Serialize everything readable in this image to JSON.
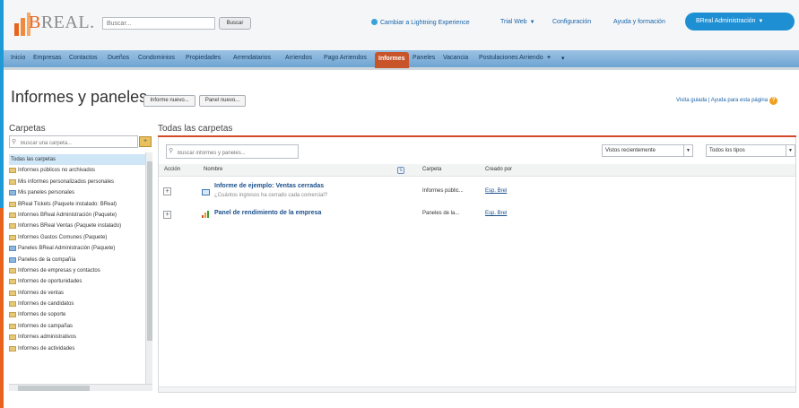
{
  "header": {
    "logo_text": "REAL",
    "logo_letter": "B",
    "search_placeholder": "Buscar...",
    "search_button": "Buscar",
    "lightning_link": "Cambiar a Lightning Experience",
    "user_switch": "Trial Web",
    "setup_link": "Configuración",
    "help_link": "Ayuda y formación",
    "user_menu": "BReal Administración"
  },
  "tabs": {
    "items": [
      "Inicio",
      "Empresas",
      "Contactos",
      "Dueños",
      "Condominios",
      "Propiedades",
      "Arrendatarios",
      "Arriendos",
      "Pago Arriendos",
      "Informes",
      "Paneles",
      "Vacancia",
      "Postulaciones Arriendo"
    ],
    "active": "Informes",
    "plus": "+",
    "more": "▾"
  },
  "title_row": {
    "title": "Informes y paneles",
    "new_report": "Informe nuevo...",
    "new_dashboard": "Panel nuevo...",
    "help_text": "Visita guiada | Ayuda para esta página"
  },
  "folders": {
    "title": "Carpetas",
    "search_placeholder": "Buscar una carpeta...",
    "items": [
      {
        "label": "Todas las carpetas",
        "icon": "none",
        "selected": true
      },
      {
        "label": "Informes públicos no archivados",
        "icon": "folder"
      },
      {
        "label": "Mis informes personalizados personales",
        "icon": "folder"
      },
      {
        "label": "Mis paneles personales",
        "icon": "dashboard"
      },
      {
        "label": "BReal Tickets (Paquete instalado: BReal)",
        "icon": "folder"
      },
      {
        "label": "Informes BReal Administración (Paquete)",
        "icon": "folder"
      },
      {
        "label": "Informes BReal Ventas (Paquete instalado)",
        "icon": "folder"
      },
      {
        "label": "Informes Gastos Comunes (Paquete)",
        "icon": "folder"
      },
      {
        "label": "Paneles BReal Administración (Paquete)",
        "icon": "dashboard"
      },
      {
        "label": "Paneles de la compañía",
        "icon": "dashboard"
      },
      {
        "label": "Informes de empresas y contactos",
        "icon": "folder"
      },
      {
        "label": "Informes de oportunidades",
        "icon": "folder"
      },
      {
        "label": "Informes de ventas",
        "icon": "folder"
      },
      {
        "label": "Informes de candidatos",
        "icon": "folder"
      },
      {
        "label": "Informes de soporte",
        "icon": "folder"
      },
      {
        "label": "Informes de campañas",
        "icon": "folder"
      },
      {
        "label": "Informes administrativos",
        "icon": "folder"
      },
      {
        "label": "Informes de actividades",
        "icon": "folder"
      }
    ]
  },
  "content": {
    "title": "Todas las carpetas",
    "search_placeholder": "Buscar informes y paneles...",
    "filter_recent": "Vistos recientemente",
    "filter_type": "Todos los tipos",
    "columns": [
      "Acción",
      "Nombre",
      "Carpeta",
      "Creado por"
    ],
    "rows": [
      {
        "type": "report",
        "name": "Informe de ejemplo: Ventas cerradas",
        "description": "¿Cuántos ingresos ha cerrado cada comercial?",
        "folder": "Informes públic...",
        "created_by": "Esp. Brel"
      },
      {
        "type": "dashboard",
        "name": "Panel de rendimiento de la empresa",
        "description": "",
        "folder": "Paneles de la...",
        "created_by": "Esp. Brel"
      }
    ]
  },
  "colors": {
    "accent_blue": "#1e9ad6",
    "accent_orange": "#e8641e",
    "active_tab": "#c8542a",
    "user_menu": "#1f8fd3"
  }
}
